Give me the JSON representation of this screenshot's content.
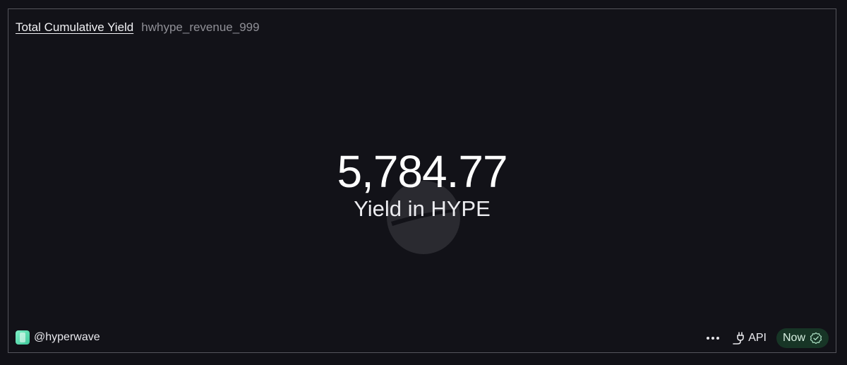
{
  "header": {
    "title": "Total Cumulative Yield",
    "query_name": "hwhype_revenue_999"
  },
  "counter": {
    "value": "5,784.77",
    "label": "Yield in HYPE"
  },
  "footer": {
    "owner_handle": "@hyperwave",
    "api_label": "API",
    "freshness_label": "Now"
  },
  "icons": {
    "avatar": "hyperwave-avatar",
    "more": "more-dots-icon",
    "api": "plug-icon",
    "status": "check-badge-icon",
    "watermark": "dune-logo-watermark"
  },
  "colors": {
    "background": "#111117",
    "border": "#55555c",
    "badge_bg": "#173526",
    "avatar_accent": "#5ad9ac"
  }
}
